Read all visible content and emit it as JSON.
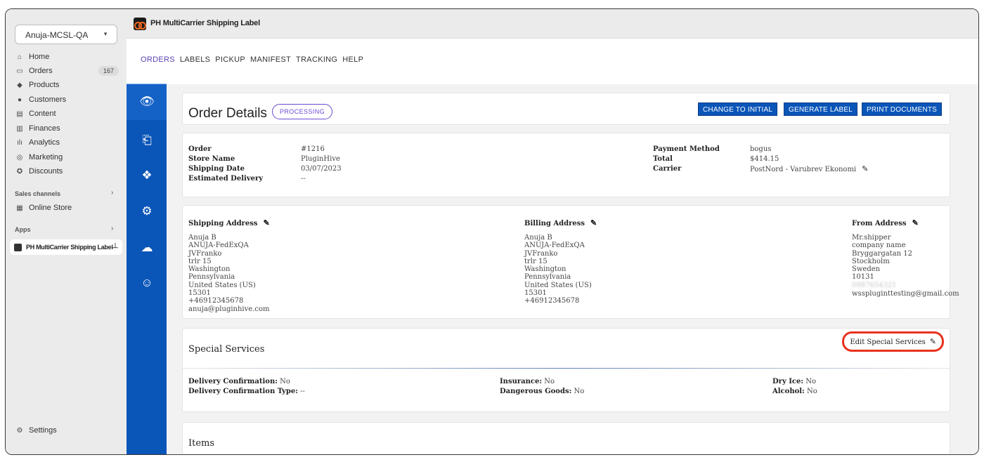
{
  "sidebar": {
    "store": "Anuja-MCSL-QA",
    "items": [
      {
        "label": "Home",
        "icon": "home-icon"
      },
      {
        "label": "Orders",
        "icon": "orders-icon",
        "badge": "167"
      },
      {
        "label": "Products",
        "icon": "tag-icon"
      },
      {
        "label": "Customers",
        "icon": "person-icon"
      },
      {
        "label": "Content",
        "icon": "content-icon"
      },
      {
        "label": "Finances",
        "icon": "bank-icon"
      },
      {
        "label": "Analytics",
        "icon": "bar-chart-icon"
      },
      {
        "label": "Marketing",
        "icon": "target-icon"
      },
      {
        "label": "Discounts",
        "icon": "discount-icon"
      }
    ],
    "sales_channels_label": "Sales channels",
    "online_store": "Online Store",
    "apps_label": "Apps",
    "app_item": "PH MultiCarrier Shipping Label",
    "settings": "Settings"
  },
  "app": {
    "title": "PH MultiCarrier Shipping Label"
  },
  "tabs": [
    "ORDERS",
    "LABELS",
    "PICKUP",
    "MANIFEST",
    "TRACKING",
    "HELP"
  ],
  "order_header": {
    "title": "Order Details",
    "status": "PROCESSING",
    "buttons": {
      "change": "CHANGE TO INITIAL",
      "generate": "GENERATE LABEL",
      "print": "PRINT DOCUMENTS"
    }
  },
  "order_info": {
    "left_labels": [
      "Order",
      "Store Name",
      "Shipping Date",
      "Estimated Delivery"
    ],
    "left_values": [
      "#1216",
      "PluginHive",
      "03/07/2023",
      "--"
    ],
    "right_labels": [
      "Payment Method",
      "Total",
      "Carrier"
    ],
    "right_values": [
      "bogus",
      "$414.15",
      "PostNord - Varubrev Ekonomi"
    ]
  },
  "addresses": {
    "shipping": {
      "title": "Shipping Address",
      "lines": "Anuja B\nANUJA-FedExQA\nJVFranko\ntrlr 15\nWashington\nPennsylvania\nUnited States (US)\n15301\n+46912345678\nanuja@pluginhive.com"
    },
    "billing": {
      "title": "Billing Address",
      "lines": "Anuja B\nANUJA-FedExQA\nJVFranko\ntrlr 15\nWashington\nPennsylvania\nUnited States (US)\n15301\n+46912345678"
    },
    "from": {
      "title": "From Address",
      "lines": "Mr.shipper\ncompany name\nBryggargatan 12\nStockholm\nSweden\n10131",
      "phone": "0987654321",
      "email": "wsspluginttesting@gmail.com"
    }
  },
  "special_services": {
    "title": "Special Services",
    "edit_label": "Edit Special Services",
    "delivery_confirmation_label": "Delivery Confirmation:",
    "delivery_confirmation": "No",
    "delivery_confirmation_type_label": "Delivery Confirmation Type:",
    "delivery_confirmation_type": "--",
    "insurance_label": "Insurance:",
    "insurance": "No",
    "dangerous_goods_label": "Dangerous Goods:",
    "dangerous_goods": "No",
    "dry_ice_label": "Dry Ice:",
    "dry_ice": "No",
    "alcohol_label": "Alcohol:",
    "alcohol": "No"
  },
  "items": {
    "title": "Items"
  },
  "colors": {
    "primary": "#0a55b8",
    "accent": "#6a4bd4",
    "highlight": "#e8321e"
  }
}
